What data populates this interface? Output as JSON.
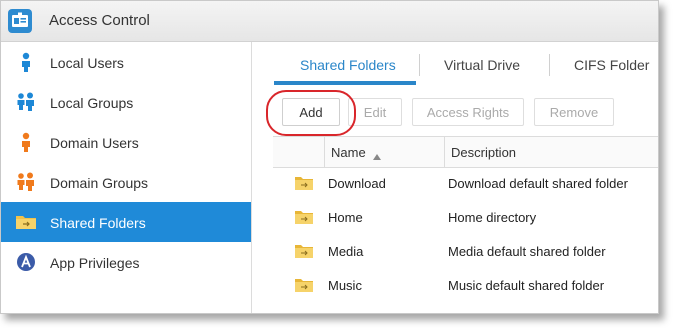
{
  "window": {
    "title": "Access Control"
  },
  "sidebar": {
    "items": [
      {
        "label": "Local Users",
        "icon": "user-icon"
      },
      {
        "label": "Local Groups",
        "icon": "group-icon"
      },
      {
        "label": "Domain Users",
        "icon": "domain-user-icon"
      },
      {
        "label": "Domain Groups",
        "icon": "domain-group-icon"
      },
      {
        "label": "Shared Folders",
        "icon": "shared-folder-icon",
        "active": true
      },
      {
        "label": "App Privileges",
        "icon": "app-privileges-icon"
      }
    ]
  },
  "tabs": [
    {
      "label": "Shared Folders",
      "active": true
    },
    {
      "label": "Virtual Drive"
    },
    {
      "label": "CIFS Folder"
    }
  ],
  "toolbar": {
    "add": "Add",
    "edit": "Edit",
    "access_rights": "Access Rights",
    "remove": "Remove"
  },
  "table": {
    "columns": {
      "name": "Name",
      "description": "Description"
    },
    "rows": [
      {
        "name": "Download",
        "description": "Download default shared folder"
      },
      {
        "name": "Home",
        "description": "Home directory"
      },
      {
        "name": "Media",
        "description": "Media default shared folder"
      },
      {
        "name": "Music",
        "description": "Music default shared folder"
      }
    ]
  },
  "colors": {
    "accent": "#1f8ad8",
    "highlight_ring": "#d9262b",
    "user_blue": "#1e88d6",
    "user_orange": "#f07a1c",
    "folder_yellow": "#f0c24b"
  }
}
